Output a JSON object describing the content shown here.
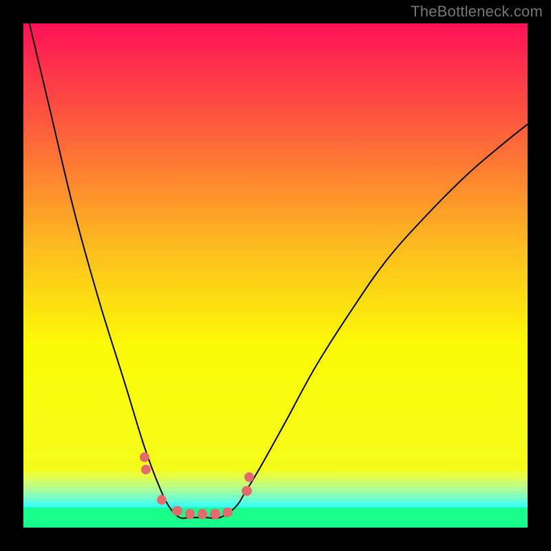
{
  "watermark": {
    "text": "TheBottleneck.com"
  },
  "chart_data": {
    "type": "line",
    "title": "",
    "xlabel": "",
    "ylabel": "",
    "xlim": [
      0,
      100
    ],
    "ylim": [
      0,
      100
    ],
    "series": [
      {
        "name": "bottleneck-curve",
        "x": [
          0,
          5,
          10,
          15,
          20,
          24,
          27,
          29,
          31,
          33,
          36,
          39,
          42,
          44,
          47,
          52,
          58,
          65,
          72,
          80,
          88,
          95,
          100
        ],
        "y": [
          105,
          84,
          63,
          45,
          29,
          16,
          8,
          4,
          2,
          2,
          2,
          2,
          4,
          7,
          12,
          21,
          32,
          43,
          53,
          62,
          70,
          76,
          80
        ]
      }
    ],
    "markers": {
      "name": "highlight-dots",
      "color": "#e46a6d",
      "radius": 7.2,
      "points": [
        {
          "x": 24.0,
          "y": 14.0
        },
        {
          "x": 24.3,
          "y": 11.5
        },
        {
          "x": 27.4,
          "y": 5.5
        },
        {
          "x": 30.5,
          "y": 3.3
        },
        {
          "x": 33.0,
          "y": 2.7
        },
        {
          "x": 35.5,
          "y": 2.7
        },
        {
          "x": 38.0,
          "y": 2.7
        },
        {
          "x": 40.5,
          "y": 3.0
        },
        {
          "x": 44.3,
          "y": 7.3
        },
        {
          "x": 44.8,
          "y": 10.0
        }
      ]
    },
    "gradient_stops": [
      {
        "pct": 0,
        "color": "#fe1256"
      },
      {
        "pct": 22,
        "color": "#fd593e"
      },
      {
        "pct": 50,
        "color": "#fdbc1f"
      },
      {
        "pct": 72,
        "color": "#fbfb06"
      },
      {
        "pct": 100,
        "color": "#f4fd1b"
      }
    ],
    "bands": [
      {
        "top": 89.0,
        "height": 1.1,
        "color": "#e7fe41"
      },
      {
        "top": 90.1,
        "height": 0.9,
        "color": "#d6fe5f"
      },
      {
        "top": 91.0,
        "height": 0.9,
        "color": "#c3fe7c"
      },
      {
        "top": 91.9,
        "height": 0.8,
        "color": "#aefe96"
      },
      {
        "top": 92.7,
        "height": 0.8,
        "color": "#97feae"
      },
      {
        "top": 93.5,
        "height": 0.7,
        "color": "#7ffec3"
      },
      {
        "top": 94.2,
        "height": 0.7,
        "color": "#65fed7"
      },
      {
        "top": 94.9,
        "height": 0.7,
        "color": "#4bffe9"
      },
      {
        "top": 95.6,
        "height": 0.5,
        "color": "#30fff8"
      },
      {
        "top": 96.1,
        "height": 3.9,
        "color": "#19ff8c"
      }
    ]
  }
}
